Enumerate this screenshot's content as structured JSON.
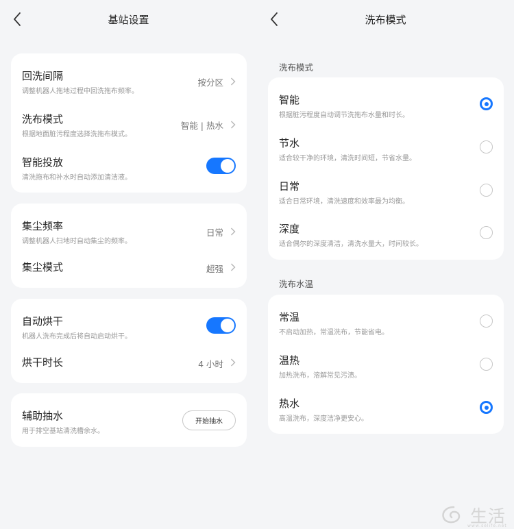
{
  "left_screen": {
    "title": "基站设置",
    "card1": {
      "rows": [
        {
          "title": "回洗间隔",
          "desc": "调整机器人拖地过程中回洗拖布频率。",
          "value": "按分区"
        },
        {
          "title": "洗布模式",
          "desc": "根据地面脏污程度选择洗拖布模式。",
          "value": "智能 | 热水"
        },
        {
          "title": "智能投放",
          "desc": "清洗拖布和补水时自动添加清洁液。",
          "toggle": true
        }
      ]
    },
    "card2": {
      "rows": [
        {
          "title": "集尘频率",
          "desc": "调整机器人扫地时自动集尘的频率。",
          "value": "日常"
        },
        {
          "title": "集尘模式",
          "value": "超强"
        }
      ]
    },
    "card3": {
      "rows": [
        {
          "title": "自动烘干",
          "desc": "机器人洗布完成后将自动启动烘干。",
          "toggle": true
        },
        {
          "title": "烘干时长",
          "value": "4 小时"
        }
      ]
    },
    "card4": {
      "title": "辅助抽水",
      "desc": "用于排空基站清洗槽余水。",
      "button": "开始抽水"
    }
  },
  "right_screen": {
    "title": "洗布模式",
    "section1": {
      "label": "洗布模式",
      "options": [
        {
          "title": "智能",
          "desc": "根据脏污程度自动调节洗拖布水量和时长。",
          "selected": true
        },
        {
          "title": "节水",
          "desc": "适合较干净的环境，清洗时间短，节省水量。",
          "selected": false
        },
        {
          "title": "日常",
          "desc": "适合日常环境，清洗速度和效率最为均衡。",
          "selected": false
        },
        {
          "title": "深度",
          "desc": "适合偶尔的深度清洁，清洗水量大，时间较长。",
          "selected": false
        }
      ]
    },
    "section2": {
      "label": "洗布水温",
      "options": [
        {
          "title": "常温",
          "desc": "不启动加热，常温洗布，节能省电。",
          "selected": false
        },
        {
          "title": "温热",
          "desc": "加热洗布，溶解常见污渍。",
          "selected": false
        },
        {
          "title": "热水",
          "desc": "高温洗布，深度洁净更安心。",
          "selected": true
        }
      ]
    }
  },
  "watermark": {
    "text": "生活",
    "url": "www.selife.net"
  },
  "colors": {
    "accent": "#1677ff",
    "background": "#f4f5f7",
    "card": "#ffffff"
  }
}
